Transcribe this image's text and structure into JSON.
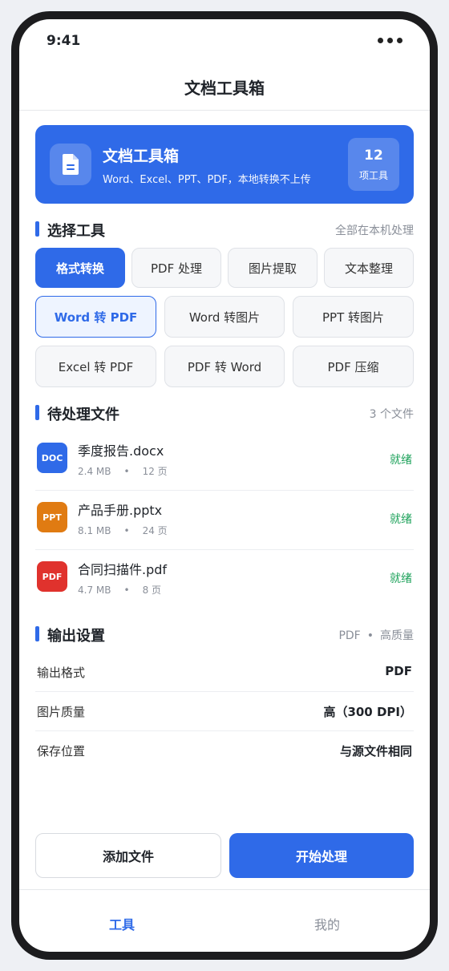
{
  "status_bar": {
    "time": "9:41"
  },
  "header": {
    "title": "文档工具箱"
  },
  "hero": {
    "title": "文档工具箱",
    "subtitle": "Word、Excel、PPT、PDF，本地转换不上传",
    "count": "12",
    "count_unit": "项工具",
    "icon": "document-icon"
  },
  "tools_section": {
    "title": "选择工具",
    "note": "全部在本机处理"
  },
  "tabs": [
    {
      "label": "格式转换",
      "active": true
    },
    {
      "label": "PDF 处理",
      "active": false
    },
    {
      "label": "图片提取",
      "active": false
    },
    {
      "label": "文本整理",
      "active": false
    }
  ],
  "options": [
    {
      "label": "Word 转 PDF",
      "active": true
    },
    {
      "label": "Word 转图片",
      "active": false
    },
    {
      "label": "PPT 转图片",
      "active": false
    },
    {
      "label": "Excel 转 PDF",
      "active": false
    },
    {
      "label": "PDF 转 Word",
      "active": false
    },
    {
      "label": "PDF 压缩",
      "active": false
    }
  ],
  "files_section": {
    "title": "待处理文件",
    "note": "3 个文件"
  },
  "files": [
    {
      "badge": "DOC",
      "badge_color": "#2f6ae8",
      "name": "季度报告.docx",
      "size": "2.4 MB",
      "pages": "12 页",
      "status": "就绪"
    },
    {
      "badge": "PPT",
      "badge_color": "#e07b12",
      "name": "产品手册.pptx",
      "size": "8.1 MB",
      "pages": "24 页",
      "status": "就绪"
    },
    {
      "badge": "PDF",
      "badge_color": "#e0322d",
      "name": "合同扫描件.pdf",
      "size": "4.7 MB",
      "pages": "8 页",
      "status": "就绪"
    }
  ],
  "meta_separator": "•",
  "output_section": {
    "title": "输出设置",
    "note_format": "PDF",
    "note_sep": "•",
    "note_quality": "高质量"
  },
  "settings": [
    {
      "key": "输出格式",
      "value": "PDF"
    },
    {
      "key": "图片质量",
      "value": "高（300 DPI）"
    },
    {
      "key": "保存位置",
      "value": "与源文件相同"
    }
  ],
  "actions": {
    "add": "添加文件",
    "start": "开始处理"
  },
  "nav": {
    "tools": "工具",
    "mine": "我的"
  },
  "colors": {
    "accent": "#2f6ae8",
    "ready": "#1ea25b"
  }
}
